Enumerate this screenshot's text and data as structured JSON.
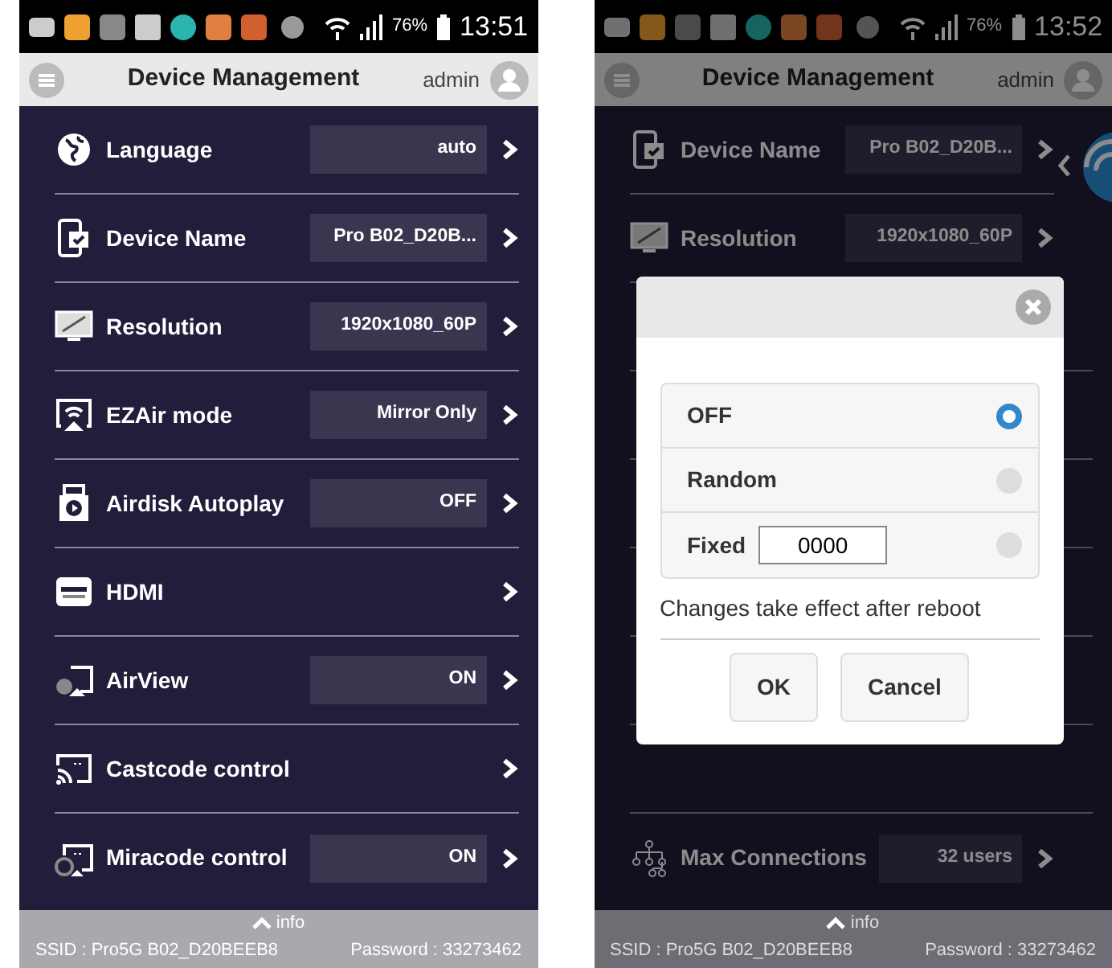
{
  "phones": [
    {
      "status_bar": {
        "battery": "76%",
        "time": "13:51"
      },
      "header": {
        "title": "Device Management",
        "user": "admin"
      },
      "settings": [
        {
          "kind": "globe",
          "label": "Language",
          "value": "auto"
        },
        {
          "kind": "device",
          "label": "Device Name",
          "value": "Pro B02_D20B..."
        },
        {
          "kind": "monitor",
          "label": "Resolution",
          "value": "1920x1080_60P"
        },
        {
          "kind": "cast",
          "label": "EZAir mode",
          "value": "Mirror Only"
        },
        {
          "kind": "airdisk",
          "label": "Airdisk Autoplay",
          "value": "OFF"
        },
        {
          "kind": "hdmi",
          "label": "HDMI"
        },
        {
          "kind": "airview",
          "label": "AirView",
          "value": "ON"
        },
        {
          "kind": "castcode",
          "label": "Castcode control"
        },
        {
          "kind": "miracode",
          "label": "Miracode control",
          "value": "ON"
        }
      ],
      "footer": {
        "toggle": "info",
        "ssid": "SSID : Pro5G B02_D20BEEB8",
        "password": "Password : 33273462"
      }
    },
    {
      "status_bar": {
        "battery": "76%",
        "time": "13:52"
      },
      "header": {
        "title": "Device Management",
        "user": "admin"
      },
      "settings": [
        {
          "kind": "device",
          "label": "Device Name",
          "value": "Pro B02_D20B..."
        },
        {
          "kind": "monitor",
          "label": "Resolution",
          "value": "1920x1080_60P"
        },
        {
          "kind": "network",
          "label": "Max Connections",
          "value": "32 users"
        }
      ],
      "footer": {
        "toggle": "info",
        "ssid": "SSID : Pro5G B02_D20BEEB8",
        "password": "Password : 33273462"
      },
      "dialog": {
        "options": [
          {
            "kind": "plain",
            "label": "OFF",
            "selected": true
          },
          {
            "kind": "plain",
            "label": "Random",
            "selected": false
          },
          {
            "kind": "input",
            "label": "Fixed",
            "value": "0000",
            "selected": false
          }
        ],
        "note": "Changes take effect after reboot",
        "buttons": [
          "OK",
          "Cancel"
        ]
      }
    }
  ]
}
